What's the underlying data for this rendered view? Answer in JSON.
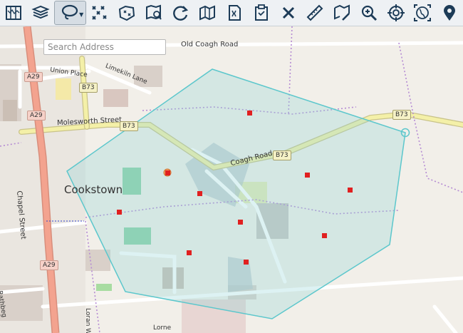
{
  "toolbar": {
    "tools": [
      {
        "name": "map-book-icon"
      },
      {
        "name": "layers-icon"
      },
      {
        "name": "lasso-select-icon",
        "active": true
      },
      {
        "name": "scatter-points-icon"
      },
      {
        "name": "polygon-draw-icon"
      },
      {
        "name": "map-zoom-icon"
      },
      {
        "name": "refresh-map-icon"
      },
      {
        "name": "folded-map-icon"
      },
      {
        "name": "bookmark-document-icon"
      },
      {
        "name": "clipboard-icon"
      },
      {
        "name": "clear-cross-icon"
      },
      {
        "name": "ruler-icon"
      },
      {
        "name": "map-edit-icon"
      },
      {
        "name": "zoom-in-icon"
      },
      {
        "name": "crosshair-target-icon"
      },
      {
        "name": "globe-extent-icon"
      },
      {
        "name": "location-pin-icon"
      }
    ]
  },
  "search": {
    "placeholder": "Search Address",
    "value": ""
  },
  "map": {
    "labels": {
      "old_coagh_road": "Old Coagh Road",
      "union_place": "Union Place",
      "limekiln_lane": "Limekiln Lane",
      "molesworth_street": "Molesworth Street",
      "coagh_road": "Coagh Road",
      "cookstown": "Cookstown",
      "chapel_street": "Chapel Street",
      "loran_way": "Loran W",
      "lorne": "Lorne",
      "rathbeg": "Rathbeg"
    },
    "shields": {
      "a29_top": "A29",
      "a29_mid": "A29",
      "a29_bottom": "A29",
      "b73_upper": "B73",
      "b73_left": "B73",
      "b73_center": "B73",
      "b73_right": "B73"
    },
    "colors": {
      "polygon_fill": "#8ed4d8",
      "polygon_stroke": "#5cc7cc",
      "marker": "#e02020",
      "a_road": "#f3a38f",
      "b_road": "#f4f0a8",
      "boundary": "#b58bd3"
    },
    "marker_count": 11
  }
}
